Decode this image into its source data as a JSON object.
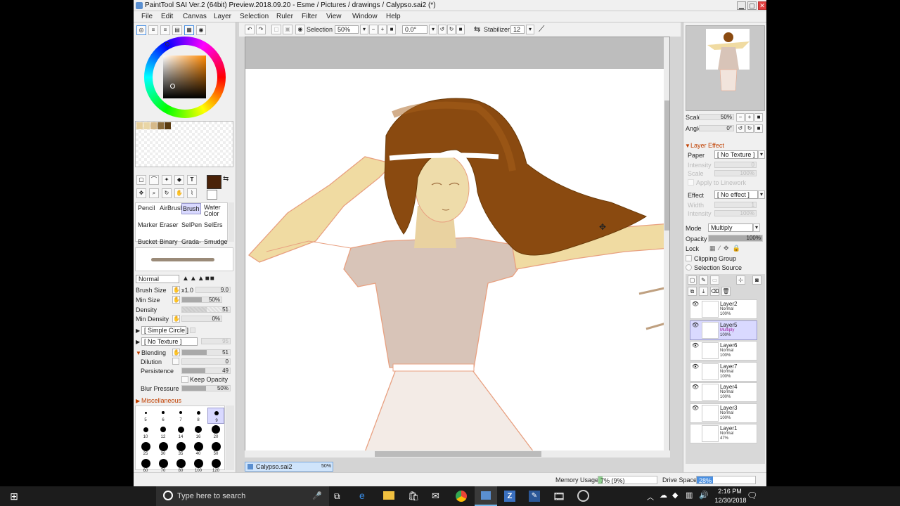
{
  "window": {
    "title": "PaintTool SAI Ver.2 (64bit) Preview.2018.09.20 - Esme / Pictures / drawings / Calypso.sai2 (*)",
    "min_icon": "▁",
    "max_icon": "▢",
    "close_icon": "✕"
  },
  "menu": [
    "File",
    "Edit",
    "Canvas",
    "Layer",
    "Selection",
    "Ruler",
    "Filter",
    "View",
    "Window",
    "Help"
  ],
  "toolbar": {
    "selection_label": "Selection",
    "zoom": "50%",
    "angle": "0.0°",
    "stabilizer_label": "Stabilizer",
    "stabilizer_value": "12"
  },
  "brush_tools": [
    {
      "label": "Pencil"
    },
    {
      "label": "AirBrush"
    },
    {
      "label": "Brush"
    },
    {
      "label": "Water Color"
    },
    {
      "label": "Marker"
    },
    {
      "label": "Eraser"
    },
    {
      "label": "SelPen"
    },
    {
      "label": "SelErs"
    },
    {
      "label": "Bucket"
    },
    {
      "label": "Binary"
    },
    {
      "label": "Grada-"
    },
    {
      "label": "Smudge"
    }
  ],
  "brush_settings": {
    "blend_mode": "Normal",
    "brush_size_label": "Brush Size",
    "brush_size_mult": "x1.0",
    "brush_size": "9.0",
    "min_size_label": "Min Size",
    "min_size": "50%",
    "density_label": "Density",
    "density": "51",
    "min_density_label": "Min Density",
    "min_density": "0%",
    "shape": "[ Simple Circle ]",
    "texture": "[ No Texture ]",
    "texture_strength": "95",
    "blending_label": "Blending",
    "blending": "51",
    "dilution_label": "Dilution",
    "dilution": "0",
    "persistence_label": "Persistence",
    "persistence": "49",
    "keep_opacity_label": "Keep Opacity",
    "blur_pressure_label": "Blur Pressure",
    "blur_pressure": "50%",
    "misc_label": "Miscellaneous"
  },
  "brush_sizes": [
    "5",
    "6",
    "7",
    "8",
    "9",
    "10",
    "12",
    "14",
    "16",
    "20",
    "25",
    "30",
    "35",
    "40",
    "50",
    "60",
    "70",
    "80",
    "100",
    "120"
  ],
  "navigator": {
    "scale_label": "Scale",
    "scale": "50%",
    "angle_label": "Angle",
    "angle": "0°"
  },
  "layer_effect": {
    "header": "Layer Effect",
    "paper_label": "Paper",
    "paper": "[ No Texture ]",
    "intensity_label": "Intensity",
    "intensity": "0",
    "scale_label": "Scale",
    "scale": "100%",
    "apply_label": "Apply to Linework",
    "effect_label": "Effect",
    "effect": "[ No effect ]",
    "width_label": "Width",
    "width": "1",
    "effect_intensity_label": "Intensity",
    "effect_intensity": "100%"
  },
  "layer_props": {
    "mode_label": "Mode",
    "mode": "Multiply",
    "opacity_label": "Opacity",
    "opacity": "100%",
    "lock_label": "Lock",
    "clipping_label": "Clipping Group",
    "selection_source_label": "Selection Source"
  },
  "layers": [
    {
      "name": "Layer2",
      "mode": "Normal",
      "opacity": "100%",
      "visible": true,
      "selected": false
    },
    {
      "name": "Layer5",
      "mode": "Multiply",
      "opacity": "100%",
      "visible": true,
      "selected": true
    },
    {
      "name": "Layer6",
      "mode": "Normal",
      "opacity": "100%",
      "visible": true,
      "selected": false
    },
    {
      "name": "Layer7",
      "mode": "Normal",
      "opacity": "100%",
      "visible": true,
      "selected": false
    },
    {
      "name": "Layer4",
      "mode": "Normal",
      "opacity": "100%",
      "visible": true,
      "selected": false
    },
    {
      "name": "Layer3",
      "mode": "Normal",
      "opacity": "100%",
      "visible": true,
      "selected": false
    },
    {
      "name": "Layer1",
      "mode": "Normal",
      "opacity": "47%",
      "visible": false,
      "selected": false
    }
  ],
  "document_tab": {
    "name": "Calypso.sai2",
    "zoom": "50%"
  },
  "status": {
    "memory_label": "Memory Usage",
    "memory": "7% (9%)",
    "drive_label": "Drive Space",
    "drive": "28%"
  },
  "taskbar": {
    "search_placeholder": "Type here to search",
    "time": "2:16 PM",
    "date": "12/30/2018"
  },
  "colors": {
    "accent": "#4a90e2",
    "selected_layer": "#d9d9ff",
    "primary_color": "#4a2208",
    "canvas_bg": "#ffffff"
  }
}
